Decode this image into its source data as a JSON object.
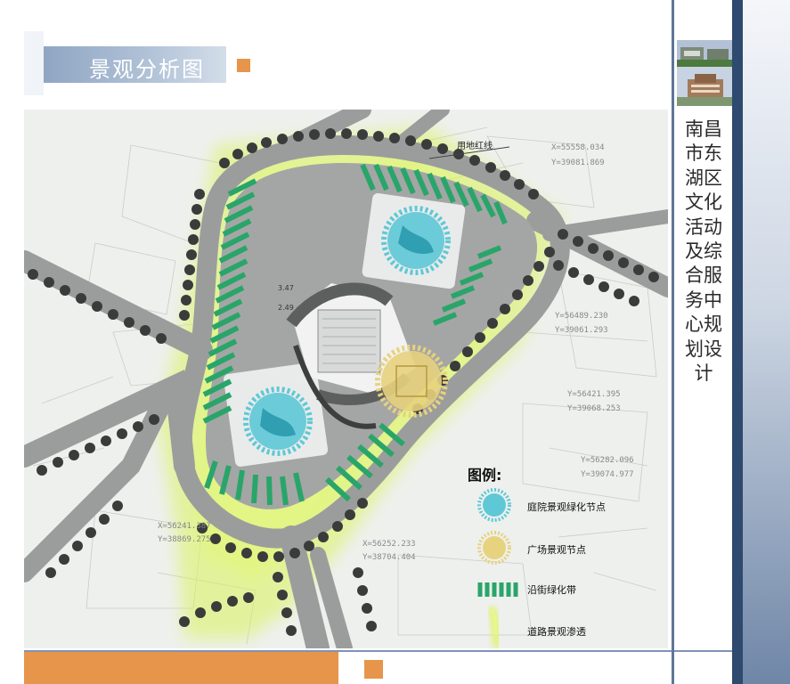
{
  "header": {
    "title": "景观分析图"
  },
  "plan": {
    "redline_label": "用地红线",
    "road_markers": [
      "3.47",
      "2.49"
    ],
    "coordinates": [
      "X=55558.034",
      "Y=39081.869",
      "Y=56489.230",
      "Y=39061.293",
      "Y=56421.395",
      "Y=39068.253",
      "Y=56282.096",
      "Y=39074.977",
      "X=56241.387",
      "Y=38869.275",
      "X=56252.233",
      "Y=38704.404"
    ]
  },
  "legend": {
    "title": "图例:",
    "items": [
      {
        "label": "庭院景观绿化节点",
        "color": "#5ec8d6",
        "symbol": "courtyard-node-icon"
      },
      {
        "label": "广场景观节点",
        "color": "#e7d27e",
        "symbol": "plaza-node-icon"
      },
      {
        "label": "沿街绿化带",
        "color": "#2aa56a",
        "symbol": "street-green-belt-icon"
      },
      {
        "label": "道路景观渗透",
        "color": "#dff36a",
        "symbol": "road-penetration-icon"
      }
    ]
  },
  "side_panel": {
    "vertical_title": "南昌市东湖区文化活动及综合服务中心规划设计"
  },
  "colors": {
    "accent": "#e6954a",
    "title_bar": "#8fa6c3",
    "navy": "#2e4a6e",
    "road": "#9b9d9c",
    "tree": "#3b3b3b",
    "green_belt": "#2aa56a",
    "glow": "#d9f25a",
    "courtyard_node": "#5ec8d6",
    "plaza_node": "#e7d27e"
  }
}
